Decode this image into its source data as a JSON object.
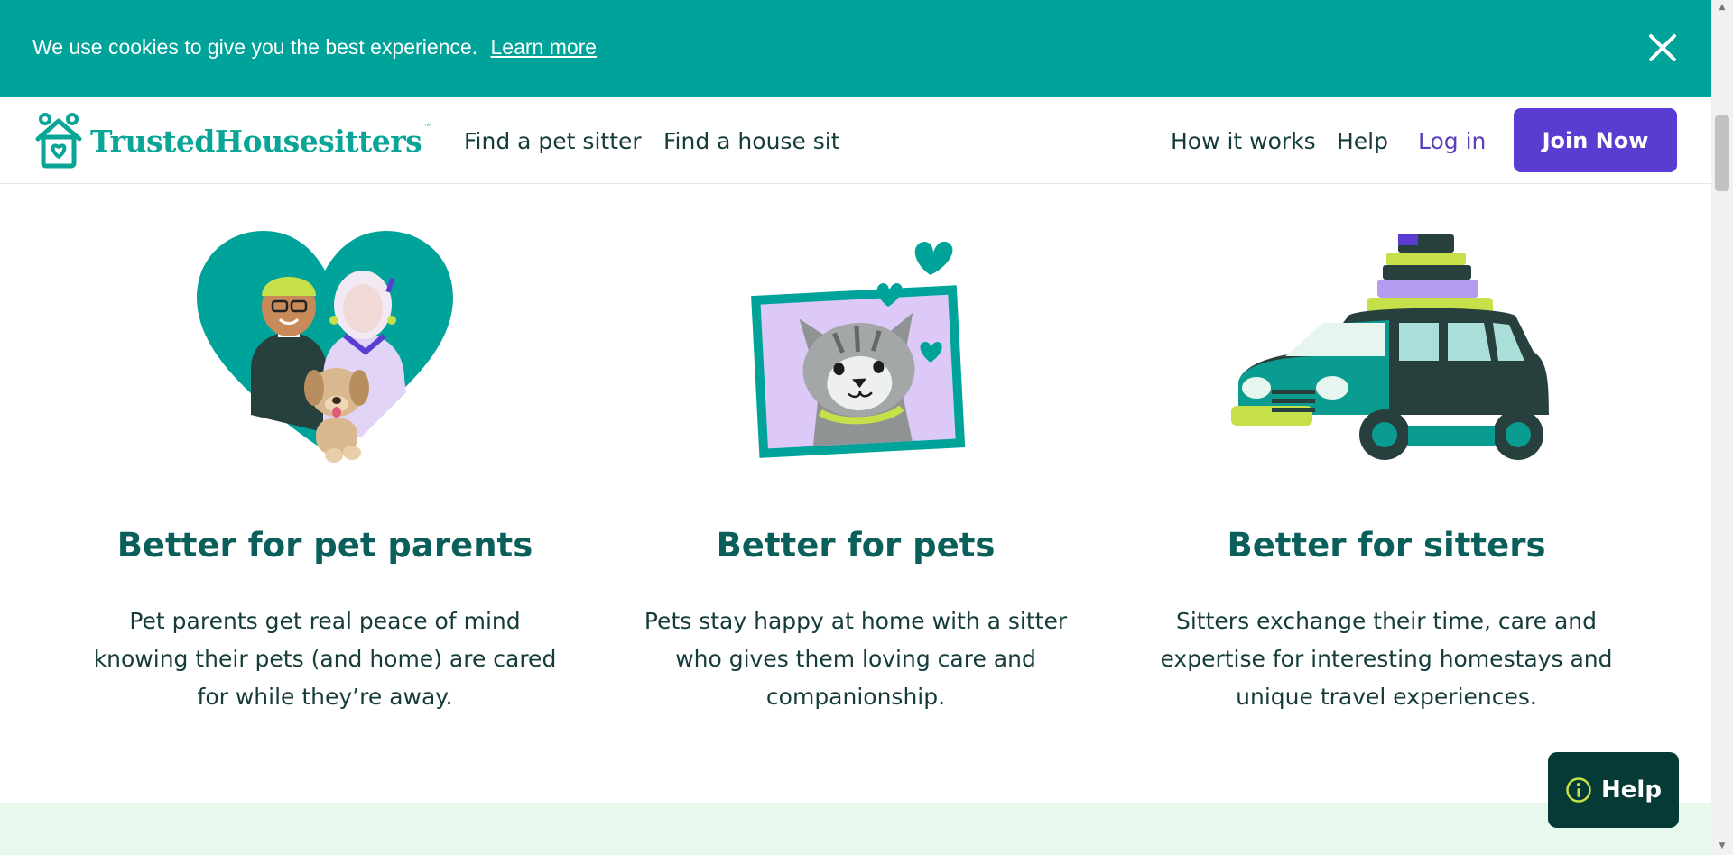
{
  "cookie_banner": {
    "message": "We use cookies to give you the best experience.",
    "link_label": "Learn more",
    "close_icon": "close-icon"
  },
  "header": {
    "logo_text": "TrustedHousesitters",
    "logo_tm": "™",
    "nav_left": [
      "Find a pet sitter",
      "Find a house sit"
    ],
    "nav_right": [
      "How it works",
      "Help"
    ],
    "login_label": "Log in",
    "join_label": "Join Now"
  },
  "features": [
    {
      "title": "Better for pet parents",
      "body": "Pet parents get real peace of mind knowing their pets (and home) are cared for while they’re away.",
      "illustration": "heart-people-dog-illustration"
    },
    {
      "title": "Better for pets",
      "body": "Pets stay happy at home with a sitter who gives them loving care and companionship.",
      "illustration": "framed-cat-illustration"
    },
    {
      "title": "Better for sitters",
      "body": "Sitters exchange their time, care and expertise for interesting homestays and unique travel experiences.",
      "illustration": "car-luggage-illustration"
    }
  ],
  "help_widget": {
    "label": "Help",
    "icon": "info-icon"
  },
  "colors": {
    "teal": "#00a39a",
    "dark_teal": "#0b5f5b",
    "purple": "#5a3dd0",
    "help_bg": "#063a36",
    "band": "#e8f8ec"
  }
}
